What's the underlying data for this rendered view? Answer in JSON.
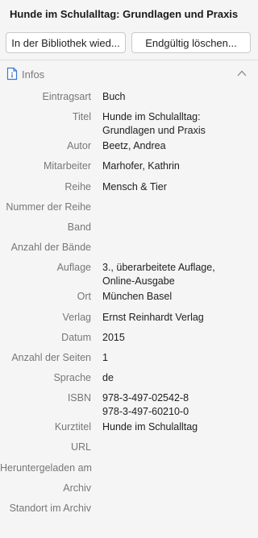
{
  "title": "Hunde im Schulalltag: Grundlagen und Praxis",
  "buttons": {
    "restore": "In der Bibliothek wied...",
    "delete": "Endgültig löschen..."
  },
  "section": {
    "title": "Infos",
    "icon": "document-info-icon",
    "collapse_icon": "chevron-up-icon",
    "accent": "#3a78d4"
  },
  "fields": [
    {
      "label": "Eintragsart",
      "value": [
        "Buch"
      ]
    },
    {
      "label": "Titel",
      "value": [
        "Hunde im Schulalltag:",
        "Grundlagen und Praxis"
      ]
    },
    {
      "label": "Autor",
      "value": [
        "Beetz, Andrea"
      ]
    },
    {
      "label": "Mitarbeiter",
      "value": [
        "Marhofer, Kathrin"
      ]
    },
    {
      "label": "Reihe",
      "value": [
        "Mensch & Tier"
      ]
    },
    {
      "label": "Nummer der Reihe",
      "value": []
    },
    {
      "label": "Band",
      "value": []
    },
    {
      "label": "Anzahl der Bände",
      "value": []
    },
    {
      "label": "Auflage",
      "value": [
        "3., überarbeitete Auflage,",
        "Online-Ausgabe"
      ]
    },
    {
      "label": "Ort",
      "value": [
        "München Basel"
      ]
    },
    {
      "label": "Verlag",
      "value": [
        "Ernst Reinhardt Verlag"
      ]
    },
    {
      "label": "Datum",
      "value": [
        "2015"
      ]
    },
    {
      "label": "Anzahl der Seiten",
      "value": [
        "1"
      ]
    },
    {
      "label": "Sprache",
      "value": [
        "de"
      ]
    },
    {
      "label": "ISBN",
      "value": [
        "978-3-497-02542-8",
        "978-3-497-60210-0"
      ]
    },
    {
      "label": "Kurztitel",
      "value": [
        "Hunde im Schulalltag"
      ]
    },
    {
      "label": "URL",
      "value": []
    },
    {
      "label": "Heruntergeladen am",
      "value": []
    },
    {
      "label": "Archiv",
      "value": []
    },
    {
      "label": "Standort im Archiv",
      "value": []
    }
  ]
}
